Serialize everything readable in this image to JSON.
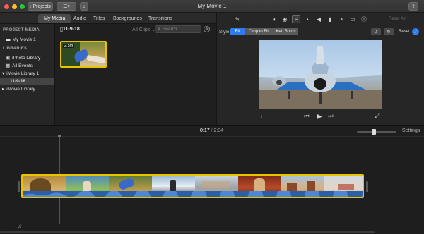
{
  "titlebar": {
    "projects_label": "Projects",
    "title": "My Movie 1"
  },
  "browser_tabs": [
    "My Media",
    "Audio",
    "Titles",
    "Backgrounds",
    "Transitions"
  ],
  "sidebar": {
    "project_media_heading": "PROJECT MEDIA",
    "project_item": "My Movie 1",
    "libraries_heading": "LIBRARIES",
    "iphoto_label": "iPhoto Library",
    "all_events_label": "All Events",
    "imovie_library_1": "iMovie Library 1",
    "event_label": "11-9-18",
    "imovie_library": "iMovie Library"
  },
  "browser": {
    "event_title": "11-9-18",
    "filter_label": "All Clips",
    "search_placeholder": "Search",
    "clip_duration": "2.5m"
  },
  "viewer": {
    "reset_all_label": "Reset All",
    "style_label": "Style:",
    "style_options": [
      "Fit",
      "Crop to Fill",
      "Ken Burns"
    ],
    "reset_label": "Reset"
  },
  "timeline": {
    "current_time": "0:17",
    "separator": "/",
    "total_time": "2:34",
    "settings_label": "Settings"
  },
  "colors": {
    "accent": "#2f7bf0",
    "clip_border": "#e8c400",
    "audio_wave": "#2d5fa8"
  }
}
